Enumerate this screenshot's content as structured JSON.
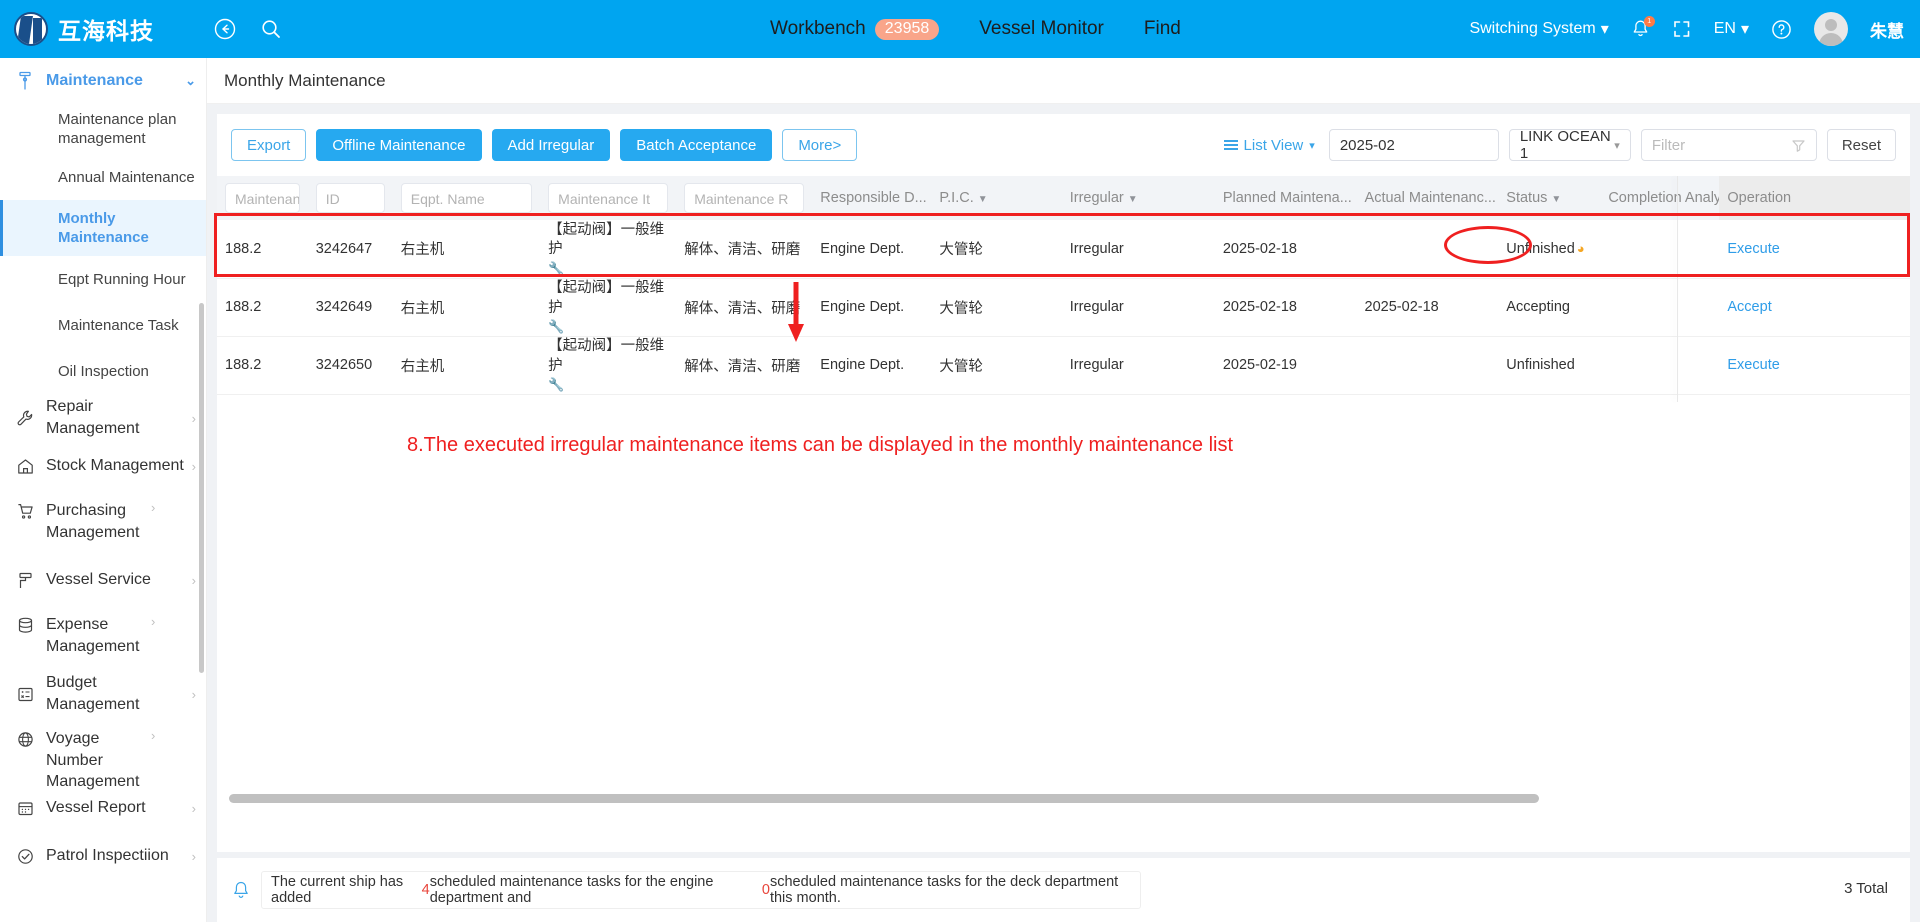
{
  "header": {
    "logo_text": "互海科技",
    "logo_icon": "company-logo-icon",
    "back_icon": "back-arrow-icon",
    "search_icon": "search-icon",
    "nav": [
      {
        "label": "Workbench",
        "badge": "23958"
      },
      {
        "label": "Vessel Monitor",
        "badge": ""
      },
      {
        "label": "Find",
        "badge": ""
      }
    ],
    "switching_system": "Switching System",
    "bell_icon": "notification-bell-icon",
    "bell_badge": "1",
    "fullscreen_icon": "fullscreen-icon",
    "language": "EN",
    "help_icon": "help-circle-icon",
    "user_name": "朱慧"
  },
  "sidebar": {
    "group": {
      "label": "Maintenance",
      "icon": "maintenance-icon",
      "chevron": "chevron-down-icon"
    },
    "sub_items": [
      {
        "label": "Maintenance plan management",
        "active": false
      },
      {
        "label": "Annual Maintenance",
        "active": false
      },
      {
        "label": "Monthly Maintenance",
        "active": true
      },
      {
        "label": "Eqpt Running Hour",
        "active": false
      },
      {
        "label": "Maintenance Task",
        "active": false
      },
      {
        "label": "Oil Inspection",
        "active": false
      }
    ],
    "groups": [
      {
        "label": "Repair Management",
        "icon": "wrench-icon"
      },
      {
        "label": "Stock Management",
        "icon": "house-icon"
      },
      {
        "label": "Purchasing Management",
        "icon": "cart-icon"
      },
      {
        "label": "Vessel Service",
        "icon": "roller-icon"
      },
      {
        "label": "Expense Management",
        "icon": "database-icon"
      },
      {
        "label": "Budget Management",
        "icon": "budget-grid-icon"
      },
      {
        "label": "Voyage Number Management",
        "icon": "globe-icon"
      },
      {
        "label": "Vessel Report",
        "icon": "calendar-icon"
      },
      {
        "label": "Patrol Inspectiion",
        "icon": "check-circle-icon"
      }
    ]
  },
  "page": {
    "title": "Monthly Maintenance"
  },
  "toolbar": {
    "buttons": [
      {
        "label": "Export",
        "style": "ghost"
      },
      {
        "label": "Offline Maintenance",
        "style": "primary"
      },
      {
        "label": "Add Irregular",
        "style": "primary"
      },
      {
        "label": "Batch Acceptance",
        "style": "primary"
      },
      {
        "label": "More>",
        "style": "ghost"
      }
    ],
    "view_toggle": "List View",
    "view_icon": "list-view-icon",
    "date_value": "2025-02",
    "vessel_value": "LINK OCEAN 1",
    "filter_placeholder": "Filter",
    "filter_icon": "filter-funnel-icon",
    "reset_label": "Reset"
  },
  "table": {
    "columns": [
      {
        "key": "c0",
        "title": "Maintenanc",
        "type": "filter"
      },
      {
        "key": "c1",
        "title": "ID",
        "type": "filter"
      },
      {
        "key": "c2",
        "title": "Eqpt. Name",
        "type": "filter"
      },
      {
        "key": "c3",
        "title": "Maintenance It",
        "type": "filter"
      },
      {
        "key": "c4",
        "title": "Maintenance R",
        "type": "filter"
      },
      {
        "key": "c5",
        "title": "Responsible D...",
        "type": "text"
      },
      {
        "key": "c6",
        "title": "P.I.C.",
        "type": "sort"
      },
      {
        "key": "c7",
        "title": "Irregular",
        "type": "sort"
      },
      {
        "key": "c8",
        "title": "Planned Maintena...",
        "type": "text"
      },
      {
        "key": "c9",
        "title": "Actual Maintenanc...",
        "type": "text"
      },
      {
        "key": "c10",
        "title": "Status",
        "type": "sort"
      },
      {
        "key": "c11",
        "title": "Completion Analy",
        "type": "text"
      },
      {
        "key": "c12",
        "title": "Operation",
        "type": "text"
      }
    ],
    "rows": [
      {
        "c0": "188.2",
        "c1": "3242647",
        "c2": "右主机",
        "c3": "【起动阀】一般维护",
        "c3_icon": "wrench-icon",
        "c4": "解体、清洁、研磨",
        "c5": "Engine Dept.",
        "c6": "大管轮",
        "c7": "Irregular",
        "c8": "2025-02-18",
        "c9": "",
        "c10": "Unfinished",
        "c10_icon": "clock-icon",
        "c11": "",
        "c12": "Execute",
        "highlight": false
      },
      {
        "c0": "188.2",
        "c1": "3242649",
        "c2": "右主机",
        "c3": "【起动阀】一般维护",
        "c3_icon": "wrench-icon",
        "c4": "解体、清洁、研磨",
        "c5": "Engine Dept.",
        "c6": "大管轮",
        "c7": "Irregular",
        "c8": "2025-02-18",
        "c9": "2025-02-18",
        "c10": "Accepting",
        "c10_icon": "",
        "c11": "",
        "c12": "Accept",
        "highlight": true
      },
      {
        "c0": "188.2",
        "c1": "3242650",
        "c2": "右主机",
        "c3": "【起动阀】一般维护",
        "c3_icon": "wrench-icon",
        "c4": "解体、清洁、研磨",
        "c5": "Engine Dept.",
        "c6": "大管轮",
        "c7": "Irregular",
        "c8": "2025-02-19",
        "c9": "",
        "c10": "Unfinished",
        "c10_icon": "",
        "c11": "",
        "c12": "Execute",
        "highlight": false
      }
    ]
  },
  "annotation": {
    "text": "8.The executed irregular maintenance items can be displayed in the monthly maintenance list",
    "color": "#ef2020"
  },
  "footer": {
    "bell_icon": "bell-outline-icon",
    "note_prefix": "The current ship has added ",
    "note_num1": "4",
    "note_mid": " scheduled maintenance tasks for the engine department and ",
    "note_num2": "0",
    "note_suffix": " scheduled maintenance tasks for the deck department this month.",
    "total": "3 Total"
  },
  "colors": {
    "brand": "#00a5f0",
    "link": "#2f9de8",
    "annotation_red": "#ef2020",
    "badge_orange": "#f9a58a"
  }
}
